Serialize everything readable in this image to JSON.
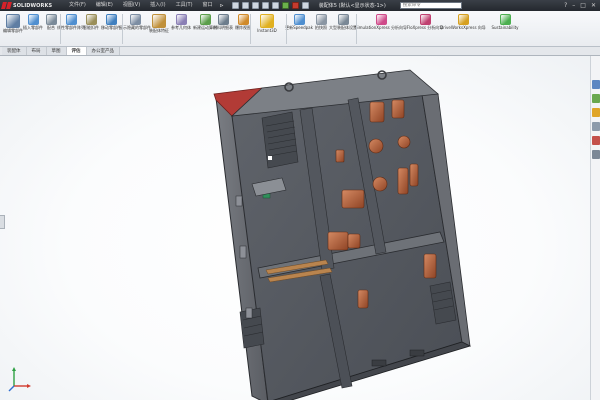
{
  "titlebar": {
    "logo_text": "SOLIDWORKS",
    "menu": [
      "文件(F)",
      "编辑(E)",
      "视图(V)",
      "插入(I)",
      "工具(T)",
      "窗口"
    ],
    "pin": "⊳",
    "doc_title": "装配体5 (默认<显示状态-1>)",
    "search_placeholder": "搜索命令",
    "controls": [
      "?",
      "–",
      "□",
      "✕"
    ]
  },
  "ribbon": {
    "buttons": [
      {
        "label": "编辑零部件",
        "icon": "edit-component-icon",
        "color": "#5f7ea3"
      },
      {
        "label": "插入零部件",
        "icon": "insert-component-icon",
        "color": "#4f8fd0"
      },
      {
        "label": "配合",
        "icon": "mate-icon",
        "color": "#7a8a99"
      },
      {
        "label": "线性零部件阵列",
        "icon": "pattern-icon",
        "color": "#4f8fd0"
      },
      {
        "label": "智能扣件",
        "icon": "smart-fastener-icon",
        "color": "#9a8f5a"
      },
      {
        "label": "移动零部件",
        "icon": "move-component-icon",
        "color": "#3f7fbf"
      },
      {
        "label": "显示隐藏的零部件",
        "icon": "show-hidden-icon",
        "color": "#7d8ea3"
      },
      {
        "label": "装配体特征",
        "icon": "assembly-feature-icon",
        "color": "#c0903a"
      },
      {
        "label": "参考几何体",
        "icon": "reference-geometry-icon",
        "color": "#8a7fb5"
      },
      {
        "label": "新建运动算例",
        "icon": "motion-study-icon",
        "color": "#5b9e4a"
      },
      {
        "label": "材料明细表",
        "icon": "bom-icon",
        "color": "#6d7d8c"
      },
      {
        "label": "爆炸视图",
        "icon": "exploded-view-icon",
        "color": "#d08a2a"
      },
      {
        "label": "Instant3D",
        "icon": "instant3d-icon",
        "color": "#e0b020"
      },
      {
        "label": "更新Speedpak",
        "icon": "speedpak-icon",
        "color": "#4f8fd0"
      },
      {
        "label": "拍快照",
        "icon": "snapshot-icon",
        "color": "#8a96a3"
      },
      {
        "label": "大型装配体设置",
        "icon": "large-assembly-icon",
        "color": "#7a8896"
      },
      {
        "label": "SimulationXpress 分析向导",
        "icon": "simulationxpress-icon",
        "color": "#cf4a8a"
      },
      {
        "label": "FloXpress 分析向导",
        "icon": "floxpress-icon",
        "color": "#c04070"
      },
      {
        "label": "DriveWorksXpress 向导",
        "icon": "driveworks-icon",
        "color": "#d6a020"
      },
      {
        "label": "Sustainability",
        "icon": "sustainability-icon",
        "color": "#4caf50"
      }
    ]
  },
  "tabs": [
    "装配体",
    "布局",
    "草图",
    "评估",
    "办公室产品"
  ],
  "active_tab": "评估",
  "colors": {
    "model_body": "#565a61",
    "model_dark": "#3e4147",
    "model_edge": "#2a2c30",
    "copper": "#b5613d",
    "red_panel": "#b23b36",
    "green_part": "#2f8f5a",
    "wood": "#b9844e"
  }
}
